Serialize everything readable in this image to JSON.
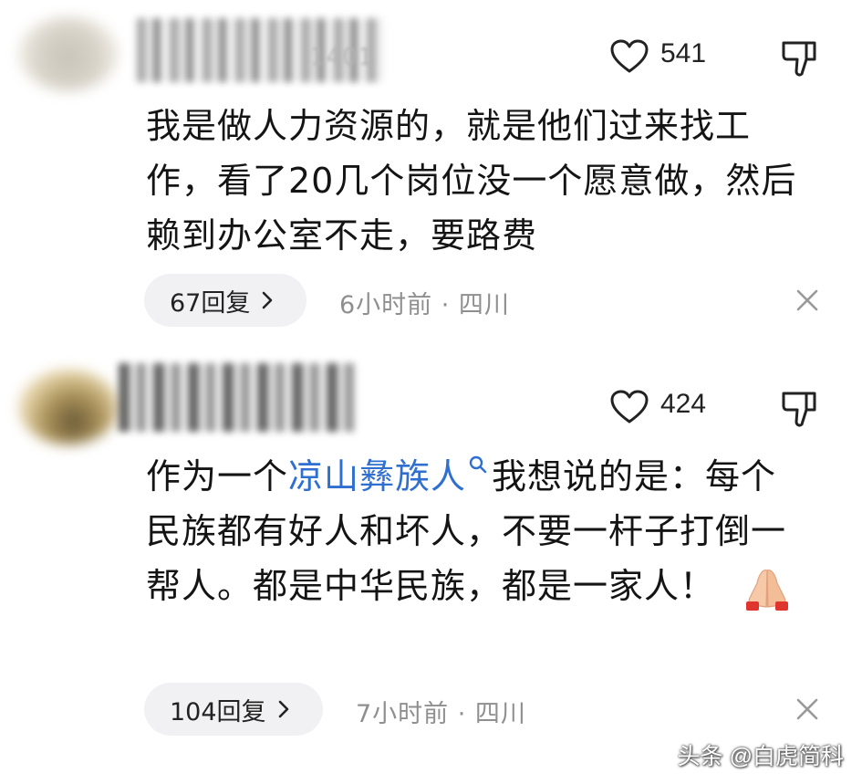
{
  "comments": [
    {
      "username": "1401",
      "likes": "541",
      "text": "我是做人力资源的，就是他们过来找工作，看了20几个岗位没一个愿意做，然后赖到办公室不走，要路费",
      "replies_label": "67回复",
      "meta": "6小时前 · 四川",
      "avatar_color": "#d8d3c9"
    },
    {
      "likes": "424",
      "text_before_topic": "作为一个",
      "topic": "凉山彝族人",
      "text_after_topic": "我想说的是：每个民族都有好人和坏人，不要一杆子打倒一帮人。都是中华民族，都是一家人！",
      "emoji": "folded-hands",
      "replies_label": "104回复",
      "meta": "7小时前 · 四川",
      "avatar_color": "#a89058"
    }
  ],
  "watermark": "头条 @白虎简科",
  "colors": {
    "topic_link": "#2f6fcf",
    "pill_bg": "#f1f1f3",
    "meta_text": "#8f8f8f"
  },
  "icons": [
    "heart-outline-icon",
    "thumbs-down-icon",
    "chevron-right-icon",
    "close-icon",
    "search-icon"
  ]
}
